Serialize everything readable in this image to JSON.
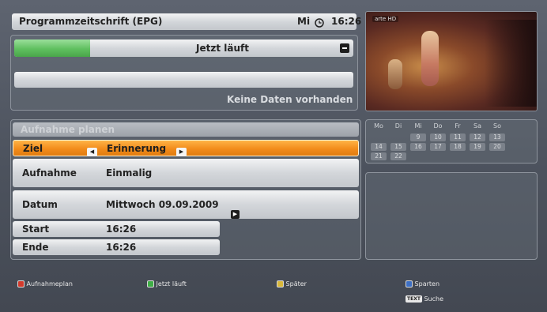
{
  "header": {
    "title": "Programmzeitschrift (EPG)",
    "day": "Mi",
    "time": "16:26",
    "clock_icon": "clock-icon"
  },
  "now_bar": {
    "label": "Jetzt läuft",
    "progress": 0.2,
    "progress_color": "#5fbf5f",
    "icon": "minus-icon"
  },
  "no_data_text": "Keine Daten vorhanden",
  "preview": {
    "channel_label": "arte HD"
  },
  "recording": {
    "heading": "Aufnahme planen",
    "rows": [
      {
        "label": "Ziel",
        "value": "Erinnerung"
      },
      {
        "label": "Aufnahme",
        "value": "Einmalig"
      },
      {
        "label": "Datum",
        "value": "Mittwoch 09.09.2009"
      },
      {
        "label": "Start",
        "value": "16:26"
      },
      {
        "label": "Ende",
        "value": "16:26"
      }
    ]
  },
  "calendar": {
    "weekdays": [
      "Mo",
      "Di",
      "Mi",
      "Do",
      "Fr",
      "Sa",
      "So"
    ],
    "weeks": [
      [
        "",
        "",
        "9",
        "10",
        "11",
        "12",
        "13"
      ],
      [
        "14",
        "15",
        "16",
        "17",
        "18",
        "19",
        "20"
      ],
      [
        "21",
        "22",
        "",
        "",
        "",
        "",
        ""
      ]
    ]
  },
  "legend": {
    "red": {
      "label": "Aufnahmeplan",
      "color": "#d23a2c"
    },
    "green": {
      "label": "Jetzt läuft",
      "color": "#3fae46"
    },
    "yellow": {
      "label": "Später",
      "color": "#d9b83a"
    },
    "blue": {
      "label": "Sparten",
      "color": "#3d6fc4"
    },
    "text": {
      "key": "TEXT",
      "label": "Suche"
    }
  },
  "colors": {
    "highlight": "#f28c1b",
    "accent_text": "#222222"
  }
}
